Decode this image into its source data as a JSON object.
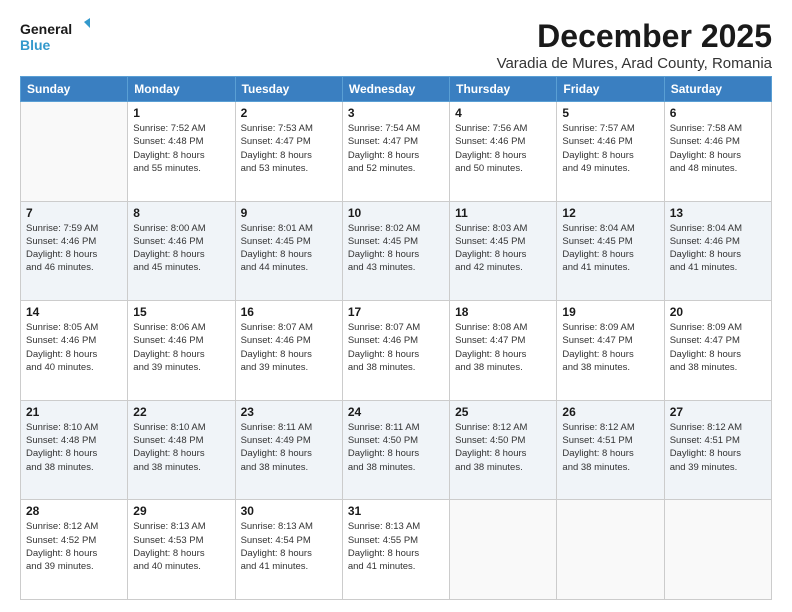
{
  "logo": {
    "line1": "General",
    "line2": "Blue"
  },
  "title": "December 2025",
  "location": "Varadia de Mures, Arad County, Romania",
  "weekdays": [
    "Sunday",
    "Monday",
    "Tuesday",
    "Wednesday",
    "Thursday",
    "Friday",
    "Saturday"
  ],
  "weeks": [
    [
      {
        "day": "",
        "info": ""
      },
      {
        "day": "1",
        "info": "Sunrise: 7:52 AM\nSunset: 4:48 PM\nDaylight: 8 hours\nand 55 minutes."
      },
      {
        "day": "2",
        "info": "Sunrise: 7:53 AM\nSunset: 4:47 PM\nDaylight: 8 hours\nand 53 minutes."
      },
      {
        "day": "3",
        "info": "Sunrise: 7:54 AM\nSunset: 4:47 PM\nDaylight: 8 hours\nand 52 minutes."
      },
      {
        "day": "4",
        "info": "Sunrise: 7:56 AM\nSunset: 4:46 PM\nDaylight: 8 hours\nand 50 minutes."
      },
      {
        "day": "5",
        "info": "Sunrise: 7:57 AM\nSunset: 4:46 PM\nDaylight: 8 hours\nand 49 minutes."
      },
      {
        "day": "6",
        "info": "Sunrise: 7:58 AM\nSunset: 4:46 PM\nDaylight: 8 hours\nand 48 minutes."
      }
    ],
    [
      {
        "day": "7",
        "info": "Sunrise: 7:59 AM\nSunset: 4:46 PM\nDaylight: 8 hours\nand 46 minutes."
      },
      {
        "day": "8",
        "info": "Sunrise: 8:00 AM\nSunset: 4:46 PM\nDaylight: 8 hours\nand 45 minutes."
      },
      {
        "day": "9",
        "info": "Sunrise: 8:01 AM\nSunset: 4:45 PM\nDaylight: 8 hours\nand 44 minutes."
      },
      {
        "day": "10",
        "info": "Sunrise: 8:02 AM\nSunset: 4:45 PM\nDaylight: 8 hours\nand 43 minutes."
      },
      {
        "day": "11",
        "info": "Sunrise: 8:03 AM\nSunset: 4:45 PM\nDaylight: 8 hours\nand 42 minutes."
      },
      {
        "day": "12",
        "info": "Sunrise: 8:04 AM\nSunset: 4:45 PM\nDaylight: 8 hours\nand 41 minutes."
      },
      {
        "day": "13",
        "info": "Sunrise: 8:04 AM\nSunset: 4:46 PM\nDaylight: 8 hours\nand 41 minutes."
      }
    ],
    [
      {
        "day": "14",
        "info": "Sunrise: 8:05 AM\nSunset: 4:46 PM\nDaylight: 8 hours\nand 40 minutes."
      },
      {
        "day": "15",
        "info": "Sunrise: 8:06 AM\nSunset: 4:46 PM\nDaylight: 8 hours\nand 39 minutes."
      },
      {
        "day": "16",
        "info": "Sunrise: 8:07 AM\nSunset: 4:46 PM\nDaylight: 8 hours\nand 39 minutes."
      },
      {
        "day": "17",
        "info": "Sunrise: 8:07 AM\nSunset: 4:46 PM\nDaylight: 8 hours\nand 38 minutes."
      },
      {
        "day": "18",
        "info": "Sunrise: 8:08 AM\nSunset: 4:47 PM\nDaylight: 8 hours\nand 38 minutes."
      },
      {
        "day": "19",
        "info": "Sunrise: 8:09 AM\nSunset: 4:47 PM\nDaylight: 8 hours\nand 38 minutes."
      },
      {
        "day": "20",
        "info": "Sunrise: 8:09 AM\nSunset: 4:47 PM\nDaylight: 8 hours\nand 38 minutes."
      }
    ],
    [
      {
        "day": "21",
        "info": "Sunrise: 8:10 AM\nSunset: 4:48 PM\nDaylight: 8 hours\nand 38 minutes."
      },
      {
        "day": "22",
        "info": "Sunrise: 8:10 AM\nSunset: 4:48 PM\nDaylight: 8 hours\nand 38 minutes."
      },
      {
        "day": "23",
        "info": "Sunrise: 8:11 AM\nSunset: 4:49 PM\nDaylight: 8 hours\nand 38 minutes."
      },
      {
        "day": "24",
        "info": "Sunrise: 8:11 AM\nSunset: 4:50 PM\nDaylight: 8 hours\nand 38 minutes."
      },
      {
        "day": "25",
        "info": "Sunrise: 8:12 AM\nSunset: 4:50 PM\nDaylight: 8 hours\nand 38 minutes."
      },
      {
        "day": "26",
        "info": "Sunrise: 8:12 AM\nSunset: 4:51 PM\nDaylight: 8 hours\nand 38 minutes."
      },
      {
        "day": "27",
        "info": "Sunrise: 8:12 AM\nSunset: 4:51 PM\nDaylight: 8 hours\nand 39 minutes."
      }
    ],
    [
      {
        "day": "28",
        "info": "Sunrise: 8:12 AM\nSunset: 4:52 PM\nDaylight: 8 hours\nand 39 minutes."
      },
      {
        "day": "29",
        "info": "Sunrise: 8:13 AM\nSunset: 4:53 PM\nDaylight: 8 hours\nand 40 minutes."
      },
      {
        "day": "30",
        "info": "Sunrise: 8:13 AM\nSunset: 4:54 PM\nDaylight: 8 hours\nand 41 minutes."
      },
      {
        "day": "31",
        "info": "Sunrise: 8:13 AM\nSunset: 4:55 PM\nDaylight: 8 hours\nand 41 minutes."
      },
      {
        "day": "",
        "info": ""
      },
      {
        "day": "",
        "info": ""
      },
      {
        "day": "",
        "info": ""
      }
    ]
  ]
}
